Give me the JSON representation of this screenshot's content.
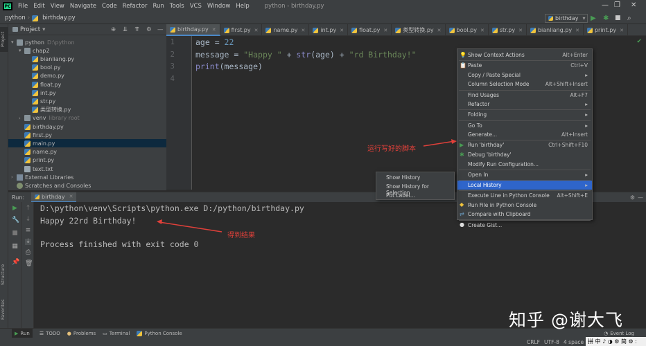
{
  "menubar": {
    "items": [
      "File",
      "Edit",
      "View",
      "Navigate",
      "Code",
      "Refactor",
      "Run",
      "Tools",
      "VCS",
      "Window",
      "Help"
    ],
    "window_title": "python - birthday.py"
  },
  "navbar": {
    "crumbs": [
      "python",
      "birthday.py"
    ],
    "run_config": "birthday"
  },
  "left_tool": {
    "project": "Project",
    "structure": "Structure",
    "favorites": "Favorites"
  },
  "project": {
    "header": "Project",
    "rows": [
      {
        "label": "python",
        "extra": "D:\\python",
        "icon": "folder-icon",
        "level": 0,
        "arrow": "▾"
      },
      {
        "label": "chap2",
        "extra": "",
        "icon": "folder-icon",
        "level": 1,
        "arrow": "▾"
      },
      {
        "label": "bianliang.py",
        "extra": "",
        "icon": "python-file-icon",
        "level": 2,
        "arrow": ""
      },
      {
        "label": "bool.py",
        "extra": "",
        "icon": "python-file-icon",
        "level": 2,
        "arrow": ""
      },
      {
        "label": "demo.py",
        "extra": "",
        "icon": "python-file-icon",
        "level": 2,
        "arrow": ""
      },
      {
        "label": "float.py",
        "extra": "",
        "icon": "python-file-icon",
        "level": 2,
        "arrow": ""
      },
      {
        "label": "int.py",
        "extra": "",
        "icon": "python-file-icon",
        "level": 2,
        "arrow": ""
      },
      {
        "label": "str.py",
        "extra": "",
        "icon": "python-file-icon",
        "level": 2,
        "arrow": ""
      },
      {
        "label": "类型转换.py",
        "extra": "",
        "icon": "python-file-icon",
        "level": 2,
        "arrow": ""
      },
      {
        "label": "venv",
        "extra": "library root",
        "icon": "folder-icon",
        "level": 1,
        "arrow": "›"
      },
      {
        "label": "birthday.py",
        "extra": "",
        "icon": "python-file-icon",
        "level": 1,
        "arrow": ""
      },
      {
        "label": "first.py",
        "extra": "",
        "icon": "python-file-icon",
        "level": 1,
        "arrow": ""
      },
      {
        "label": "main.py",
        "extra": "",
        "icon": "python-file-icon",
        "level": 1,
        "arrow": ""
      },
      {
        "label": "name.py",
        "extra": "",
        "icon": "python-file-icon",
        "level": 1,
        "arrow": ""
      },
      {
        "label": "print.py",
        "extra": "",
        "icon": "python-file-icon",
        "level": 1,
        "arrow": ""
      },
      {
        "label": "text.txt",
        "extra": "",
        "icon": "text-file-icon",
        "level": 1,
        "arrow": ""
      },
      {
        "label": "External Libraries",
        "extra": "",
        "icon": "library-icon",
        "level": 0,
        "arrow": "›"
      },
      {
        "label": "Scratches and Consoles",
        "extra": "",
        "icon": "scratches-icon",
        "level": 0,
        "arrow": ""
      }
    ]
  },
  "tabs": [
    "birthday.py",
    "first.py",
    "name.py",
    "int.py",
    "float.py",
    "类型转换.py",
    "bool.py",
    "str.py",
    "bianliang.py",
    "print.py"
  ],
  "editor": {
    "line_numbers": [
      "1",
      "2",
      "3",
      "4"
    ],
    "lines": [
      [
        {
          "t": "age = ",
          "c": ""
        },
        {
          "t": "22",
          "c": "n"
        }
      ],
      [
        {
          "t": "message = ",
          "c": ""
        },
        {
          "t": "\"Happy \"",
          "c": "s"
        },
        {
          "t": " + ",
          "c": ""
        },
        {
          "t": "str",
          "c": "b"
        },
        {
          "t": "(age) + ",
          "c": ""
        },
        {
          "t": "\"rd Birthday!\"",
          "c": "s"
        }
      ],
      [
        {
          "t": "print",
          "c": "b"
        },
        {
          "t": "(message)",
          "c": ""
        }
      ]
    ]
  },
  "run": {
    "label": "Run:",
    "tab": "birthday",
    "console": [
      "D:\\python\\venv\\Scripts\\python.exe D:/python/birthday.py",
      "Happy 22rd Birthday!",
      "",
      "Process finished with exit code 0"
    ]
  },
  "context_menu": [
    {
      "label": "Show Context Actions",
      "shortcut": "Alt+Enter",
      "icon": "bulb-icon",
      "arrow": false,
      "hl": false
    },
    {
      "sep": true
    },
    {
      "label": "Paste",
      "shortcut": "Ctrl+V",
      "icon": "paste-icon",
      "arrow": false,
      "hl": false
    },
    {
      "label": "Copy / Paste Special",
      "shortcut": "",
      "icon": "",
      "arrow": true,
      "hl": false
    },
    {
      "label": "Column Selection Mode",
      "shortcut": "Alt+Shift+Insert",
      "icon": "",
      "arrow": false,
      "hl": false
    },
    {
      "sep": true
    },
    {
      "label": "Find Usages",
      "shortcut": "Alt+F7",
      "icon": "",
      "arrow": false,
      "hl": false
    },
    {
      "label": "Refactor",
      "shortcut": "",
      "icon": "",
      "arrow": true,
      "hl": false
    },
    {
      "sep": true
    },
    {
      "label": "Folding",
      "shortcut": "",
      "icon": "",
      "arrow": true,
      "hl": false
    },
    {
      "sep": true
    },
    {
      "label": "Go To",
      "shortcut": "",
      "icon": "",
      "arrow": true,
      "hl": false
    },
    {
      "label": "Generate...",
      "shortcut": "Alt+Insert",
      "icon": "",
      "arrow": false,
      "hl": false
    },
    {
      "sep": true
    },
    {
      "label": "Run 'birthday'",
      "shortcut": "Ctrl+Shift+F10",
      "icon": "run-icon",
      "arrow": false,
      "hl": false
    },
    {
      "label": "Debug 'birthday'",
      "shortcut": "",
      "icon": "debug-icon",
      "arrow": false,
      "hl": false
    },
    {
      "label": "Modify Run Configuration...",
      "shortcut": "",
      "icon": "",
      "arrow": false,
      "hl": false
    },
    {
      "sep": true
    },
    {
      "label": "Open In",
      "shortcut": "",
      "icon": "",
      "arrow": true,
      "hl": false
    },
    {
      "sep": true
    },
    {
      "label": "Local History",
      "shortcut": "",
      "icon": "",
      "arrow": true,
      "hl": true
    },
    {
      "sep": true
    },
    {
      "label": "Execute Line in Python Console",
      "shortcut": "Alt+Shift+E",
      "icon": "",
      "arrow": false,
      "hl": false
    },
    {
      "label": "Run File in Python Console",
      "shortcut": "",
      "icon": "python-icon",
      "arrow": false,
      "hl": false
    },
    {
      "label": "Compare with Clipboard",
      "shortcut": "",
      "icon": "compare-icon",
      "arrow": false,
      "hl": false
    },
    {
      "sep": true
    },
    {
      "label": "Create Gist...",
      "shortcut": "",
      "icon": "github-icon",
      "arrow": false,
      "hl": false
    }
  ],
  "submenu": [
    "Show History",
    "Show History for Selection",
    "Put Label..."
  ],
  "notes": {
    "run_note": "运行写好的脚本",
    "result_note": "得到结果"
  },
  "bottom_tabs": [
    "Run",
    "TODO",
    "Problems",
    "Terminal",
    "Python Console"
  ],
  "status": {
    "crlf": "CRLF",
    "enc": "UTF-8",
    "indent": "4 space",
    "event_log": "Event Log"
  },
  "watermark": "知乎 @谢大飞",
  "ime": "拼 中 ♪ ◑ ⚙ 简 ⚙ :"
}
